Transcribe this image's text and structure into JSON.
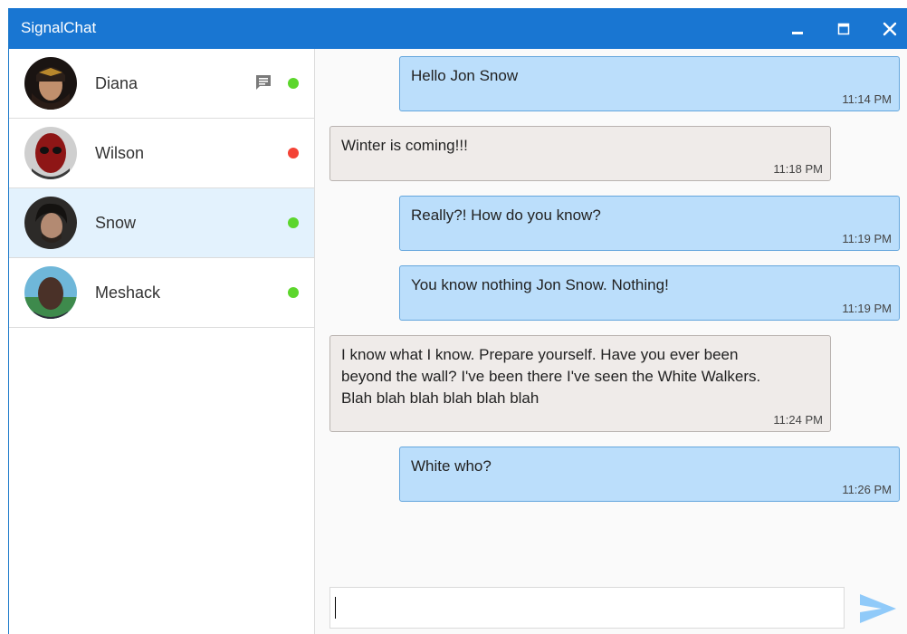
{
  "window": {
    "title": "SignalChat"
  },
  "contacts": [
    {
      "name": "Diana",
      "status": "online",
      "status_color": "#5cd62c",
      "has_unread": true,
      "selected": false
    },
    {
      "name": "Wilson",
      "status": "busy",
      "status_color": "#f44336",
      "has_unread": false,
      "selected": false
    },
    {
      "name": "Snow",
      "status": "online",
      "status_color": "#5cd62c",
      "has_unread": false,
      "selected": true
    },
    {
      "name": "Meshack",
      "status": "online",
      "status_color": "#5cd62c",
      "has_unread": false,
      "selected": false
    }
  ],
  "messages": [
    {
      "text": "Hello Jon Snow",
      "time": "11:14 PM",
      "direction": "outgoing"
    },
    {
      "text": "Winter is coming!!!",
      "time": "11:18 PM",
      "direction": "incoming"
    },
    {
      "text": "Really?! How do you know?",
      "time": "11:19 PM",
      "direction": "outgoing"
    },
    {
      "text": "You know nothing Jon Snow. Nothing!",
      "time": "11:19 PM",
      "direction": "outgoing"
    },
    {
      "text": "I know what I know. Prepare yourself. Have you ever been beyond the wall? I've been there I've seen the White Walkers. Blah blah blah blah blah blah",
      "time": "11:24 PM",
      "direction": "incoming"
    },
    {
      "text": "White who?",
      "time": "11:26 PM",
      "direction": "outgoing"
    }
  ],
  "composer": {
    "value": "",
    "placeholder": ""
  },
  "icons": {
    "minimize": "minimize-icon",
    "maximize": "maximize-icon",
    "close": "close-icon",
    "unread": "message-icon",
    "send": "send-icon"
  },
  "colors": {
    "titlebar": "#1976d2",
    "outgoing_bubble": "#bbdefb",
    "incoming_bubble": "#efebe9",
    "selected_contact": "#e3f2fd",
    "online": "#5cd62c",
    "busy": "#f44336",
    "send_icon": "#90caf9"
  }
}
